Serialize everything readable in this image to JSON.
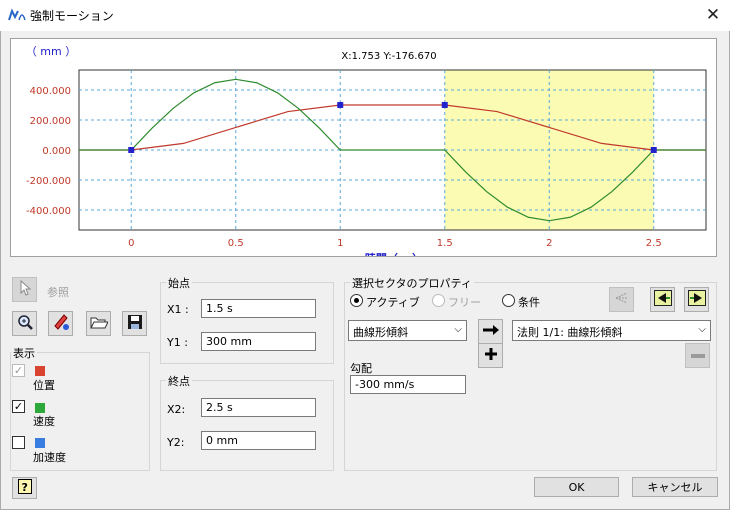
{
  "window": {
    "title": "強制モーション",
    "close_glyph": "✕"
  },
  "chart": {
    "unit_label": "（ mm ）",
    "cursor_readout": "X:1.753 Y:-176.670",
    "xlabel": "時間（ s ）"
  },
  "chart_data": {
    "type": "line",
    "x_ticks": [
      "0",
      "0.5",
      "1",
      "1.5",
      "2",
      "2.5"
    ],
    "y_ticks": [
      "400.000",
      "200.000",
      "0.000",
      "-200.000",
      "-400.000"
    ],
    "xlim": [
      -0.25,
      2.75
    ],
    "ylim": [
      -533,
      533
    ],
    "grid": true,
    "highlight_range": [
      1.5,
      2.5
    ],
    "control_points": [
      [
        0,
        0
      ],
      [
        1,
        300
      ],
      [
        1.5,
        300
      ],
      [
        2.5,
        0
      ]
    ],
    "series": [
      {
        "name": "位置",
        "color": "#c0392b",
        "x": [
          -0.25,
          0,
          0.25,
          0.5,
          0.75,
          1,
          1.25,
          1.5,
          1.75,
          2,
          2.25,
          2.5,
          2.75
        ],
        "y": [
          0,
          0,
          44,
          150,
          256,
          300,
          300,
          300,
          256,
          150,
          44,
          0,
          0
        ]
      },
      {
        "name": "速度",
        "color": "#2e8b2e",
        "x": [
          -0.25,
          0,
          0.1,
          0.2,
          0.3,
          0.4,
          0.5,
          0.6,
          0.7,
          0.8,
          0.9,
          1,
          1.25,
          1.5,
          1.6,
          1.7,
          1.8,
          1.9,
          2,
          2.1,
          2.2,
          2.3,
          2.4,
          2.5,
          2.75
        ],
        "y": [
          0,
          0,
          146,
          277,
          381,
          448,
          471,
          448,
          381,
          277,
          146,
          0,
          0,
          0,
          -146,
          -277,
          -381,
          -448,
          -471,
          -448,
          -381,
          -277,
          -146,
          0,
          0
        ]
      }
    ]
  },
  "toolbar": {
    "ref_label": "参照"
  },
  "display": {
    "title": "表示",
    "items": [
      {
        "label": "位置",
        "checked": "✓",
        "color": "#d9432f"
      },
      {
        "label": "速度",
        "checked": "✓",
        "color": "#2ea83a"
      },
      {
        "label": "加速度",
        "checked": "",
        "color": "#3a7de0"
      }
    ]
  },
  "start": {
    "title": "始点",
    "x_label": "X1 :",
    "x_value": "1.5 s",
    "y_label": "Y1 :",
    "y_value": "300 mm"
  },
  "end": {
    "title": "終点",
    "x_label": "X2:",
    "x_value": "2.5 s",
    "y_label": "Y2:",
    "y_value": "0 mm"
  },
  "props": {
    "title": "選択セクタのプロパティ",
    "radio_active": "アクティブ",
    "radio_free": "フリー",
    "radio_cond": "条件",
    "shape_select": "曲線形傾斜",
    "rule_select": "法則 1/1: 曲線形傾斜",
    "slope_label": "勾配",
    "slope_value": "-300 mm/s"
  },
  "buttons": {
    "ok": "OK",
    "cancel": "キャンセル"
  }
}
